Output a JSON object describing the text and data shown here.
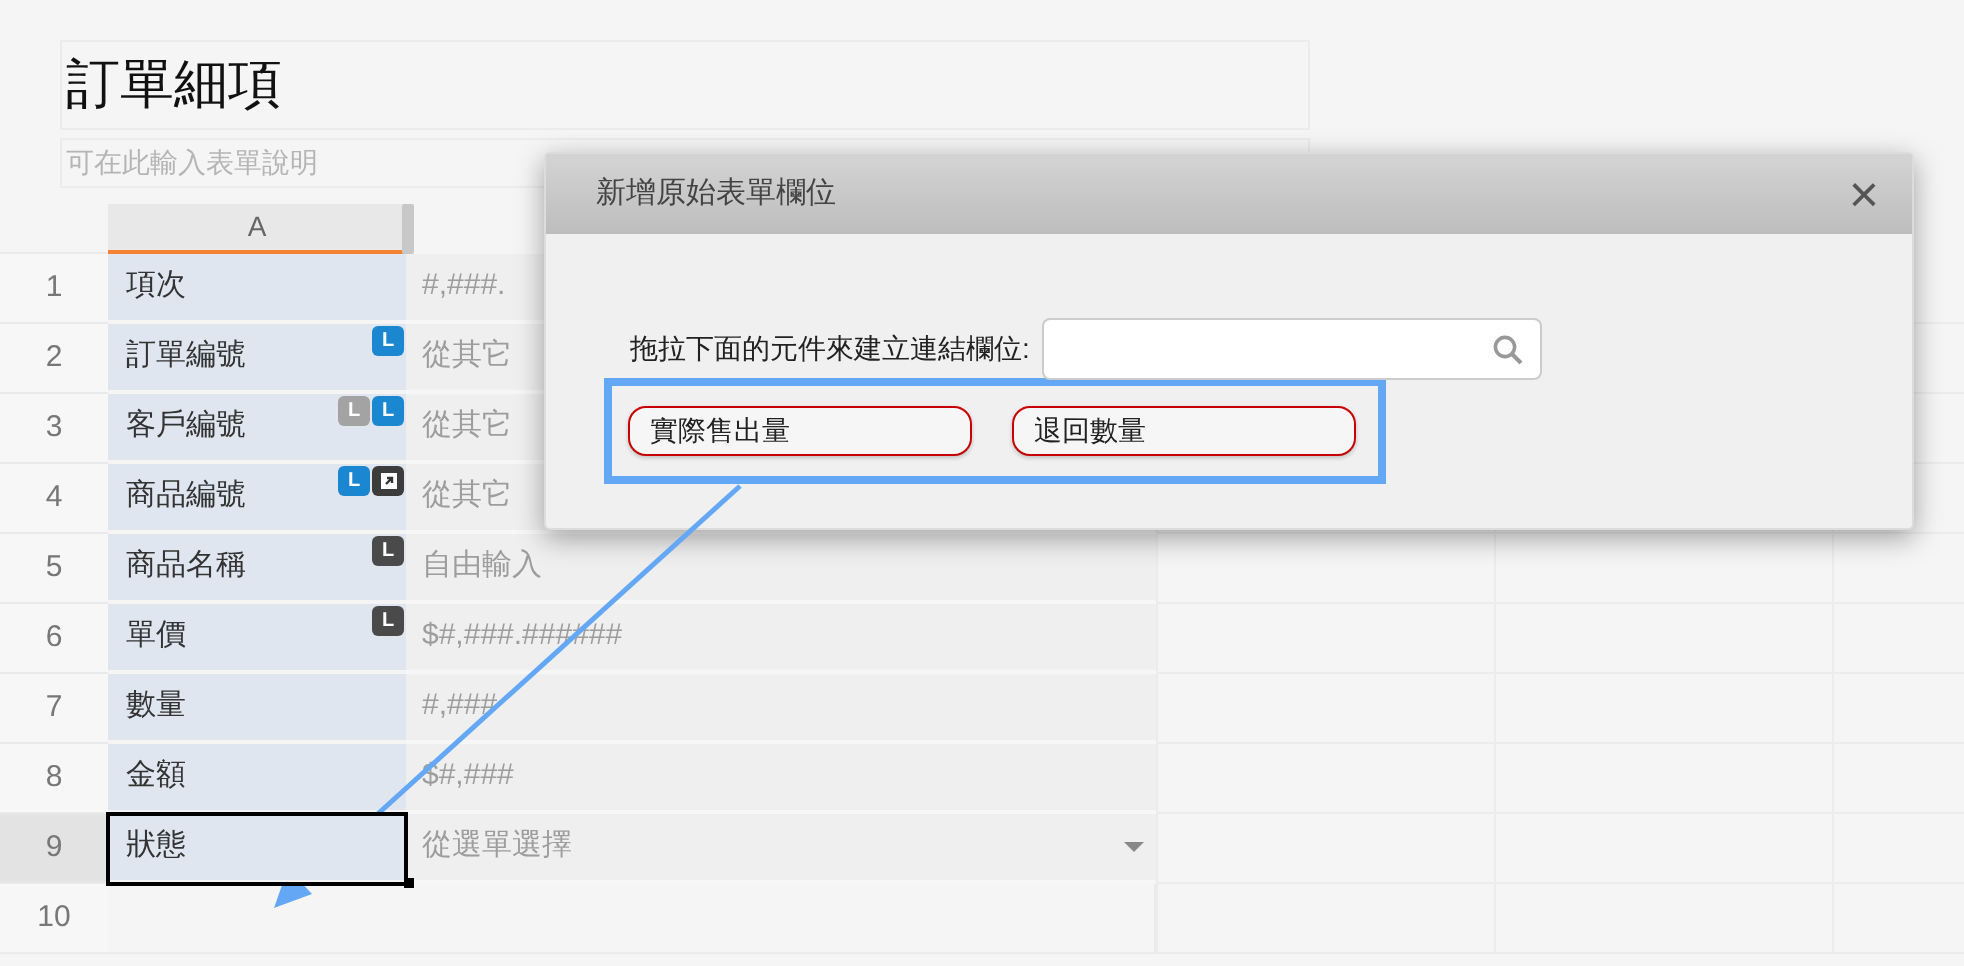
{
  "form": {
    "title": "訂單細項",
    "description_placeholder": "可在此輸入表單說明"
  },
  "grid": {
    "columns": [
      "A"
    ],
    "rows": [
      {
        "number": "1",
        "label": "項次",
        "format": "#,###.",
        "badges": [],
        "selected": false,
        "dropdown": false
      },
      {
        "number": "2",
        "label": "訂單編號",
        "format": "從其它",
        "badges": [
          {
            "kind": "letter",
            "text": "L",
            "color": "#1a87d0"
          }
        ],
        "selected": false,
        "dropdown": false
      },
      {
        "number": "3",
        "label": "客戶編號",
        "format": "從其它",
        "badges": [
          {
            "kind": "letter",
            "text": "L",
            "color": "#a3a3a3"
          },
          {
            "kind": "letter",
            "text": "L",
            "color": "#1a87d0"
          }
        ],
        "selected": false,
        "dropdown": false
      },
      {
        "number": "4",
        "label": "商品編號",
        "format": "從其它",
        "badges": [
          {
            "kind": "letter",
            "text": "L",
            "color": "#1a87d0"
          },
          {
            "kind": "link",
            "color": "#3c3c3c"
          }
        ],
        "selected": false,
        "dropdown": false
      },
      {
        "number": "5",
        "label": "商品名稱",
        "format": "自由輸入",
        "badges": [
          {
            "kind": "letter",
            "text": "L",
            "color": "#4a4a4a"
          }
        ],
        "selected": false,
        "dropdown": false
      },
      {
        "number": "6",
        "label": "單價",
        "format": "$#,###.######",
        "badges": [
          {
            "kind": "letter",
            "text": "L",
            "color": "#4a4a4a"
          }
        ],
        "selected": false,
        "dropdown": false
      },
      {
        "number": "7",
        "label": "數量",
        "format": "#,###",
        "badges": [],
        "selected": false,
        "dropdown": false
      },
      {
        "number": "8",
        "label": "金額",
        "format": "$#,###",
        "badges": [],
        "selected": false,
        "dropdown": false
      },
      {
        "number": "9",
        "label": "狀態",
        "format": "從選單選擇",
        "badges": [],
        "selected": true,
        "dropdown": true
      },
      {
        "number": "10",
        "badges": [],
        "selected": false
      }
    ]
  },
  "dialog": {
    "title": "新增原始表單欄位",
    "close": "×",
    "search_label": "拖拉下面的元件來建立連結欄位:",
    "fields": [
      "實際售出量",
      "退回數量"
    ]
  }
}
